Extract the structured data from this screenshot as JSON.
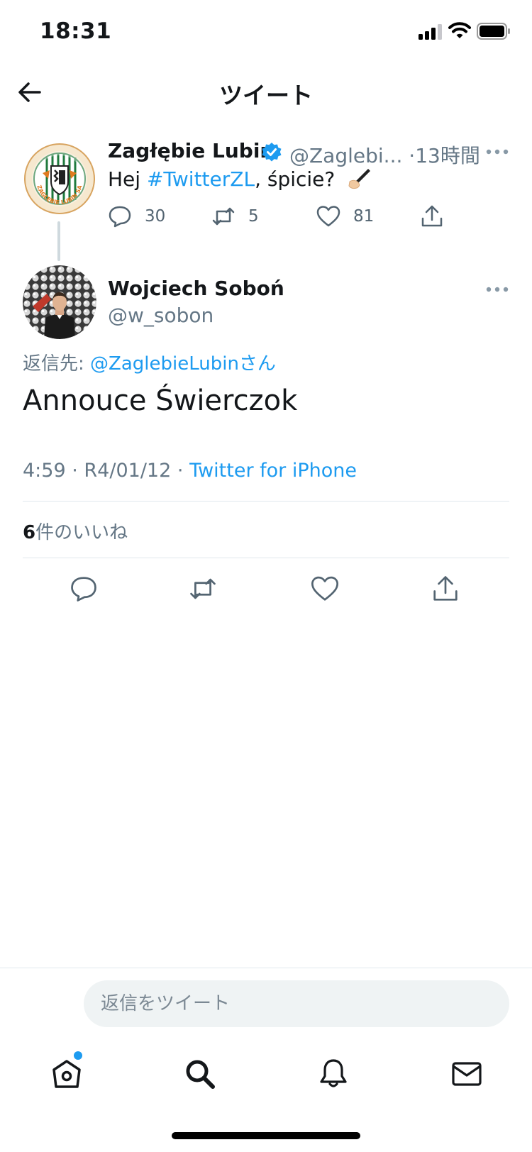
{
  "status_bar": {
    "time": "18:31"
  },
  "header": {
    "title": "ツイート"
  },
  "parent_tweet": {
    "name": "Zagłębie Lubin",
    "handle": "@Zaglebi...",
    "time": "13時間",
    "text_prefix": "Hej ",
    "hashtag": "#TwitterZL",
    "text_suffix": ", śpicie?",
    "counts": {
      "replies": "30",
      "retweets": "5",
      "likes": "81"
    },
    "avatar_text": "ZAGŁĘBIE LUBIN SA"
  },
  "main_tweet": {
    "name": "Wojciech Soboń",
    "handle": "@w_sobon",
    "reply_to_label": "返信先: ",
    "reply_to_handle": "@ZaglebieLubinさん",
    "text": "Annouce Świerczok",
    "time": "4:59",
    "date": "R4/01/12",
    "separator": "·",
    "source": "Twitter for iPhone",
    "likes_count": "6",
    "likes_label": "件のいいね"
  },
  "reply_bar": {
    "placeholder": "返信をツイート"
  },
  "colors": {
    "accent": "#1d9bf0",
    "text": "#14171a",
    "secondary": "#657786"
  }
}
